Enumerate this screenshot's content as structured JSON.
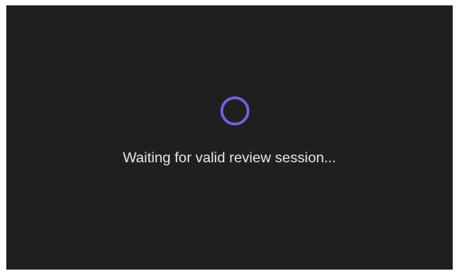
{
  "loading": {
    "status_text": "Waiting for valid review session...",
    "spinner_icon": "loading-spinner-icon",
    "accent_color": "#7b5ce6",
    "background_color": "#1f1f1f"
  }
}
